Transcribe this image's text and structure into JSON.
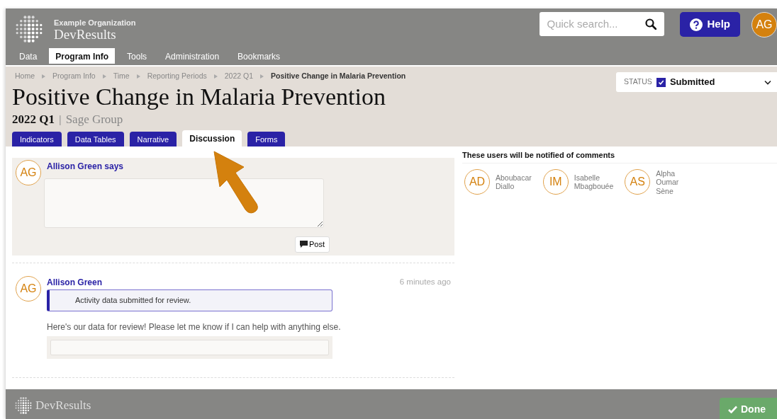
{
  "header": {
    "organization": "Example Organization",
    "app_name": "DevResults",
    "search": {
      "placeholder": "Quick search..."
    },
    "help_button": "Help",
    "user_initials": "AG"
  },
  "nav_tabs": [
    {
      "label": "Data",
      "selected": false
    },
    {
      "label": "Program Info",
      "selected": true
    },
    {
      "label": "Tools",
      "selected": false
    },
    {
      "label": "Administration",
      "selected": false
    },
    {
      "label": "Bookmarks",
      "selected": false
    }
  ],
  "breadcrumb": [
    "Home",
    "Program Info",
    "Time",
    "Reporting Periods",
    "2022 Q1",
    "Positive Change in Malaria Prevention"
  ],
  "status": {
    "label": "STATUS",
    "value": "Submitted",
    "checked": true
  },
  "page_title": "Positive Change in Malaria Prevention",
  "period": "2022 Q1",
  "separator": "|",
  "group": "Sage Group",
  "tabs": [
    {
      "label": "Indicators",
      "selected": false
    },
    {
      "label": "Data Tables",
      "selected": false
    },
    {
      "label": "Narrative",
      "selected": false
    },
    {
      "label": "Discussion",
      "selected": true
    },
    {
      "label": "Forms",
      "selected": false
    }
  ],
  "new_comment": {
    "initials": "AG",
    "heading": "Allison Green says",
    "post_button": "Post"
  },
  "comments": [
    {
      "initials": "AG",
      "author": "Allison Green",
      "time": "6 minutes ago",
      "event": "Activity data submitted for review.",
      "text": "Here's our data for review! Please let me know if I can help with anything else."
    }
  ],
  "notified": {
    "heading": "These users will be notified of comments",
    "users": [
      {
        "initials": "AD",
        "name": "Aboubacar Diallo"
      },
      {
        "initials": "IM",
        "name": "Isabelle Mbagbouée"
      },
      {
        "initials": "AS",
        "name": "Alpha Oumar Sène"
      }
    ]
  },
  "footer": {
    "app_name": "DevResults",
    "done_button": "Done"
  }
}
